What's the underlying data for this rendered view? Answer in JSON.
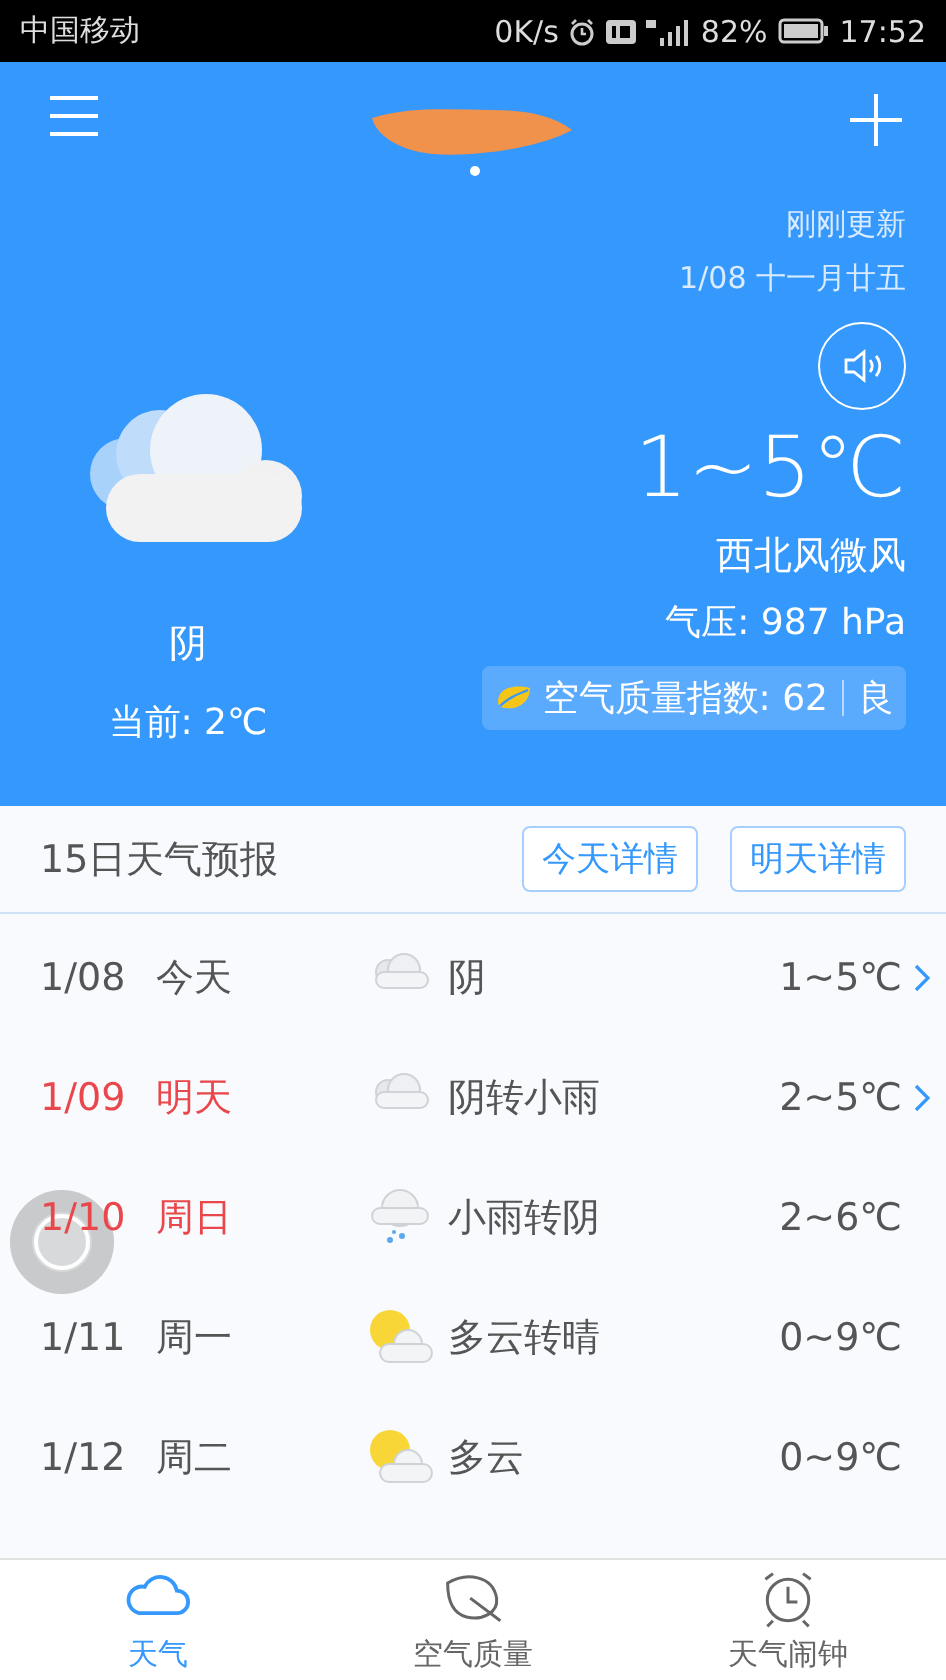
{
  "status_bar": {
    "carrier": "中国移动",
    "speed": "0K/s",
    "battery": "82%",
    "time": "17:52"
  },
  "header": {
    "updated": "刚刚更新",
    "date": "1/08 十一月廿五",
    "condition": "阴",
    "current": "当前: 2℃",
    "temp_range": "1~5℃",
    "wind": "西北风微风",
    "pressure": "气压: 987 hPa",
    "aqi_label": "空气质量指数: 62",
    "aqi_level": "良"
  },
  "forecast": {
    "title": "15日天气预报",
    "buttons": [
      "今天详情",
      "明天详情"
    ],
    "rows": [
      {
        "date": "1/08",
        "day": "今天",
        "weather": "阴",
        "kind": "overcast",
        "temp": "1~5℃",
        "weekend": false,
        "has_detail": true
      },
      {
        "date": "1/09",
        "day": "明天",
        "weather": "阴转小雨",
        "kind": "overcast",
        "temp": "2~5℃",
        "weekend": true,
        "has_detail": true
      },
      {
        "date": "1/10",
        "day": "周日",
        "weather": "小雨转阴",
        "kind": "rain",
        "temp": "2~6℃",
        "weekend": true,
        "has_detail": false
      },
      {
        "date": "1/11",
        "day": "周一",
        "weather": "多云转晴",
        "kind": "partly-cloudy",
        "temp": "0~9℃",
        "weekend": false,
        "has_detail": false
      },
      {
        "date": "1/12",
        "day": "周二",
        "weather": "多云",
        "kind": "partly-cloudy",
        "temp": "0~9℃",
        "weekend": false,
        "has_detail": false
      }
    ]
  },
  "tabs": [
    {
      "label": "天气",
      "selected": true
    },
    {
      "label": "空气质量",
      "selected": false
    },
    {
      "label": "天气闹钟",
      "selected": false
    }
  ]
}
